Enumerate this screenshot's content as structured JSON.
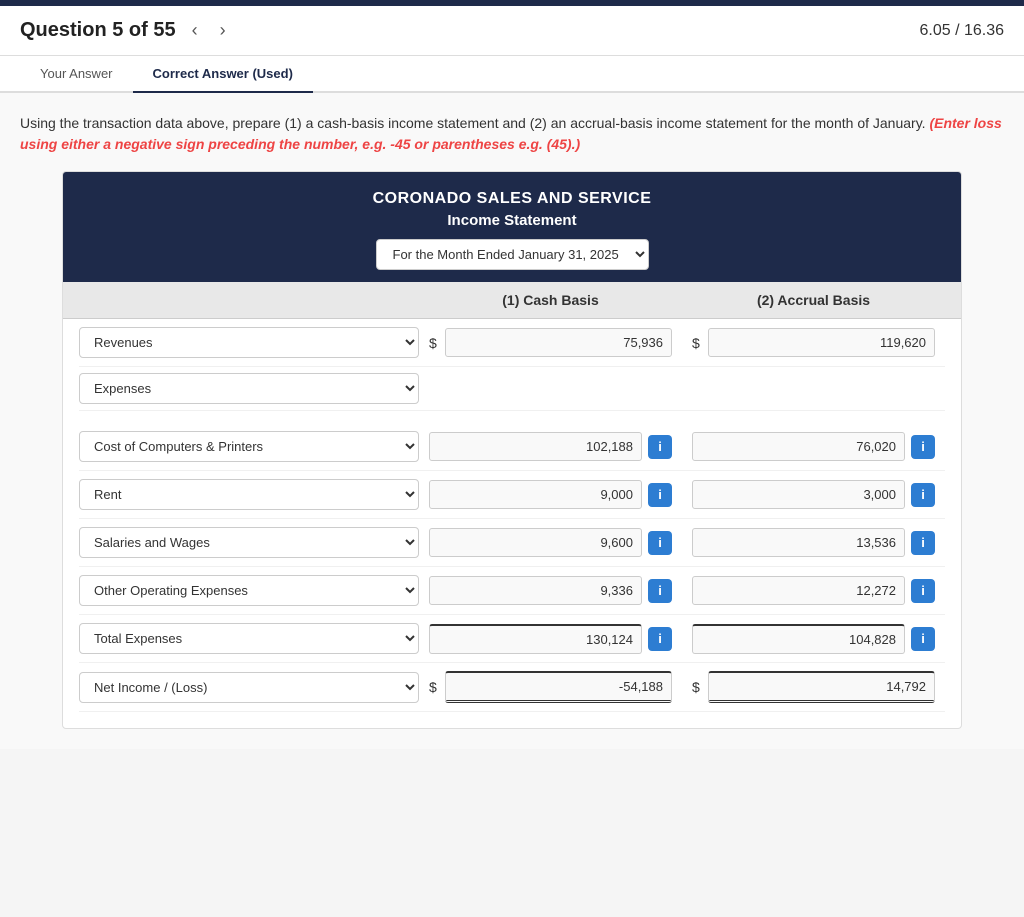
{
  "topBar": {},
  "header": {
    "question": "Question 5 of 55",
    "score": "6.05 / 16.36",
    "prevArrow": "‹",
    "nextArrow": "›"
  },
  "tabs": [
    {
      "label": "Your Answer",
      "active": false
    },
    {
      "label": "Correct Answer (Used)",
      "active": true
    }
  ],
  "instructions": {
    "main": "Using the transaction data above, prepare (1) a cash-basis income statement and (2) an accrual-basis income statement for the month of January.",
    "warning": "(Enter loss using either a negative sign preceding the number, e.g. -45 or parentheses e.g. (45).)"
  },
  "card": {
    "companyNamePart1": "CORONADO",
    "companyNameBold": "SALES AND SERVICE",
    "statementTitle": "Income Statement",
    "period": "For the Month Ended January 31, 2025",
    "periodOptions": [
      "For the Month Ended January 31, 2025"
    ],
    "columns": {
      "col1": "(1) Cash Basis",
      "col2": "(2) Accrual Basis"
    },
    "rows": [
      {
        "id": "revenues",
        "label": "Revenues",
        "showDollar": true,
        "cash": "75,936",
        "accrual": "119,620",
        "showInfo": false,
        "isTotal": false,
        "isNetIncome": false
      },
      {
        "id": "expenses",
        "label": "Expenses",
        "showDollar": false,
        "cash": "",
        "accrual": "",
        "showInfo": false,
        "isExpenseHeader": true
      },
      {
        "id": "cost-computers",
        "label": "Cost of Computers & Printers",
        "showDollar": false,
        "cash": "102,188",
        "accrual": "76,020",
        "showInfo": true
      },
      {
        "id": "rent",
        "label": "Rent",
        "showDollar": false,
        "cash": "9,000",
        "accrual": "3,000",
        "showInfo": true
      },
      {
        "id": "salaries",
        "label": "Salaries and Wages",
        "showDollar": false,
        "cash": "9,600",
        "accrual": "13,536",
        "showInfo": true
      },
      {
        "id": "other-operating",
        "label": "Other Operating Expenses",
        "showDollar": false,
        "cash": "9,336",
        "accrual": "12,272",
        "showInfo": true
      },
      {
        "id": "total-expenses",
        "label": "Total Expenses",
        "showDollar": false,
        "cash": "130,124",
        "accrual": "104,828",
        "showInfo": true,
        "isTotal": true
      },
      {
        "id": "net-income",
        "label": "Net Income / (Loss)",
        "showDollar": true,
        "cash": "-54,188",
        "accrual": "14,792",
        "showInfo": false,
        "isNetIncome": true
      }
    ],
    "infoIcon": "i"
  }
}
